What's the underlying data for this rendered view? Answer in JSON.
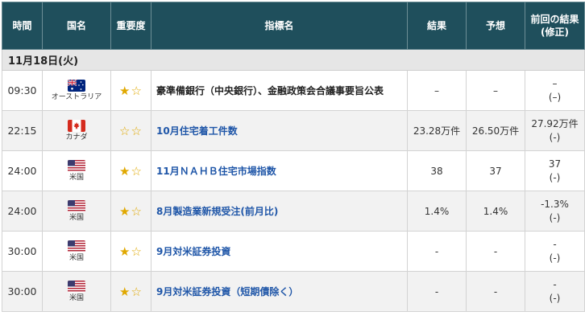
{
  "header": {
    "time": "時間",
    "country": "国名",
    "importance": "重要度",
    "indicator": "指標名",
    "result": "結果",
    "forecast": "予想",
    "previous_line1": "前回の結果",
    "previous_line2": "(修正)"
  },
  "date_label": "11月18日(火)",
  "rows": [
    {
      "time": "09:30",
      "country": "オーストラリア",
      "flag_icon": "australia-flag-icon",
      "stars": "★☆",
      "indicator": "豪準備銀行（中央銀行）、金融政策会合議事要旨公表",
      "link": false,
      "result": "–",
      "forecast": "–",
      "previous": "–",
      "revised": "(–)"
    },
    {
      "time": "22:15",
      "country": "カナダ",
      "flag_icon": "canada-flag-icon",
      "stars": "☆☆",
      "indicator": "10月住宅着工件数",
      "link": true,
      "result": "23.28万件",
      "forecast": "26.50万件",
      "previous": "27.92万件",
      "revised": "(-)"
    },
    {
      "time": "24:00",
      "country": "米国",
      "flag_icon": "usa-flag-icon",
      "stars": "★☆",
      "indicator": "11月ＮＡＨＢ住宅市場指数",
      "link": true,
      "result": "38",
      "forecast": "37",
      "previous": "37",
      "revised": "(-)"
    },
    {
      "time": "24:00",
      "country": "米国",
      "flag_icon": "usa-flag-icon",
      "stars": "★☆",
      "indicator": "8月製造業新規受注(前月比)",
      "link": true,
      "result": "1.4%",
      "forecast": "1.4%",
      "previous": "-1.3%",
      "revised": "(-)"
    },
    {
      "time": "30:00",
      "country": "米国",
      "flag_icon": "usa-flag-icon",
      "stars": "★☆",
      "indicator": "9月対米証券投資",
      "link": true,
      "result": "-",
      "forecast": "-",
      "previous": "-",
      "revised": "(-)"
    },
    {
      "time": "30:00",
      "country": "米国",
      "flag_icon": "usa-flag-icon",
      "stars": "★☆",
      "indicator": "9月対米証券投資（短期債除く）",
      "link": true,
      "result": "-",
      "forecast": "-",
      "previous": "-",
      "revised": "(-)"
    }
  ],
  "colors": {
    "header_bg": "#1f4f5c",
    "date_bg": "#e6e6e6",
    "alt_row_bg": "#f2f2f2",
    "link": "#1f56a8",
    "star": "#e0a800"
  }
}
